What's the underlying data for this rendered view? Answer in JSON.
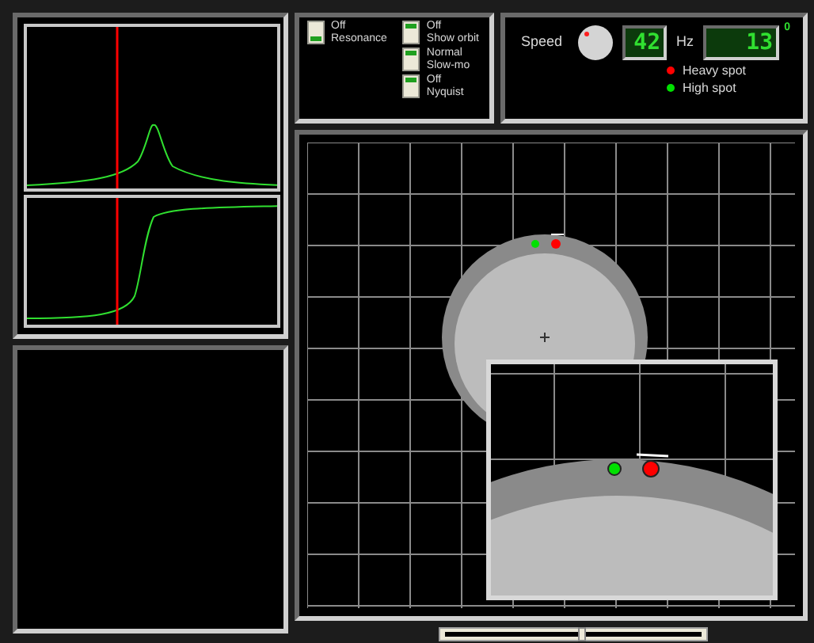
{
  "toggles": [
    {
      "state": "Off",
      "label": "Resonance",
      "up": false
    },
    {
      "state": "Off",
      "label": "Show orbit",
      "up": true
    },
    {
      "state": "Normal",
      "label": "Slow-mo",
      "up": true
    },
    {
      "state": "Off",
      "label": "Nyquist",
      "up": true
    }
  ],
  "speed": {
    "label": "Speed",
    "rpm_display": "42",
    "unit": "Hz",
    "counter_display": "13",
    "indicator": "0"
  },
  "legend": [
    {
      "label": "Heavy spot",
      "color": "#ff0000"
    },
    {
      "label": "High spot",
      "color": "#00e000"
    }
  ],
  "playback_slider": {
    "level": 0.53
  }
}
